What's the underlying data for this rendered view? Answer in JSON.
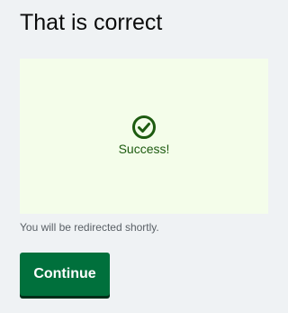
{
  "page": {
    "title": "That is correct"
  },
  "status": {
    "icon": "check-circle-icon",
    "message": "Success!",
    "color": "#1d5b10",
    "background": "#f4fdea"
  },
  "redirect": {
    "note": "You will be redirected shortly."
  },
  "actions": {
    "continue_label": "Continue",
    "continue_color": "#00703c"
  }
}
